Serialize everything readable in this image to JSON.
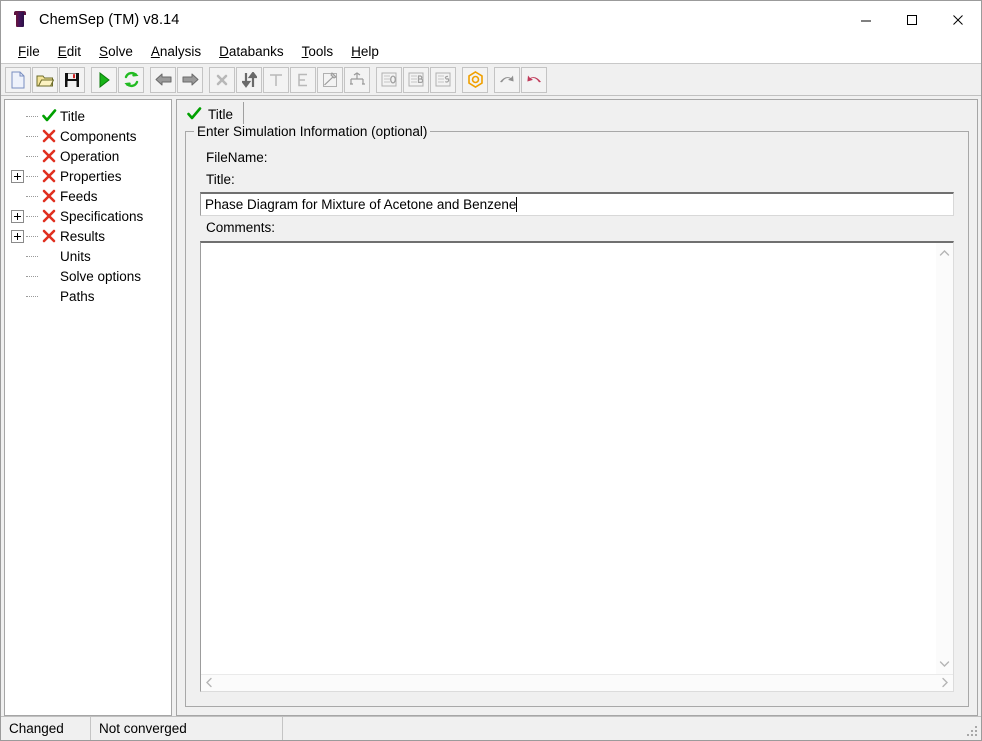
{
  "window": {
    "title": "ChemSep (TM) v8.14",
    "icon": "chemsep-flask-icon",
    "controls": {
      "minimize": "minimize-icon",
      "maximize": "maximize-icon",
      "close": "close-icon"
    }
  },
  "menubar": {
    "items": [
      {
        "label": "File",
        "accel": "F"
      },
      {
        "label": "Edit",
        "accel": "E"
      },
      {
        "label": "Solve",
        "accel": "S"
      },
      {
        "label": "Analysis",
        "accel": "A"
      },
      {
        "label": "Databanks",
        "accel": "D"
      },
      {
        "label": "Tools",
        "accel": "T"
      },
      {
        "label": "Help",
        "accel": "H"
      }
    ]
  },
  "toolbar": {
    "buttons": [
      {
        "name": "new-file-icon",
        "tip": "New",
        "enabled": true
      },
      {
        "name": "open-folder-icon",
        "tip": "Open",
        "enabled": true
      },
      {
        "name": "save-disk-icon",
        "tip": "Save",
        "enabled": true
      },
      {
        "name": "run-play-icon",
        "tip": "Solve",
        "enabled": true
      },
      {
        "name": "refresh-icon",
        "tip": "Refresh",
        "enabled": true
      },
      {
        "name": "arrow-left-icon",
        "tip": "Back",
        "enabled": true
      },
      {
        "name": "arrow-right-icon",
        "tip": "Forward",
        "enabled": true
      },
      {
        "name": "close-x-icon",
        "tip": "Close",
        "enabled": false
      },
      {
        "name": "sort-updown-icon",
        "tip": "Sort",
        "enabled": true
      },
      {
        "name": "table-t-icon",
        "tip": "Table",
        "enabled": false
      },
      {
        "name": "editor-e-icon",
        "tip": "Editor",
        "enabled": false
      },
      {
        "name": "plot-pen-icon",
        "tip": "Plot",
        "enabled": false
      },
      {
        "name": "flowsheet-icon",
        "tip": "Flowsheet",
        "enabled": false
      },
      {
        "name": "report-o-icon",
        "tip": "Report O",
        "enabled": false
      },
      {
        "name": "report-b-icon",
        "tip": "Report B",
        "enabled": false
      },
      {
        "name": "report-s-icon",
        "tip": "Report S",
        "enabled": false
      },
      {
        "name": "properties-hex-icon",
        "tip": "Properties",
        "enabled": true
      },
      {
        "name": "redo-arrow-icon",
        "tip": "Redo",
        "enabled": true
      },
      {
        "name": "undo-arrow-icon",
        "tip": "Undo",
        "enabled": true
      }
    ]
  },
  "sidebar": {
    "nodes": [
      {
        "label": "Title",
        "status": "check",
        "expandable": false
      },
      {
        "label": "Components",
        "status": "cross",
        "expandable": false
      },
      {
        "label": "Operation",
        "status": "cross",
        "expandable": false
      },
      {
        "label": "Properties",
        "status": "cross",
        "expandable": true
      },
      {
        "label": "Feeds",
        "status": "cross",
        "expandable": false
      },
      {
        "label": "Specifications",
        "status": "cross",
        "expandable": true
      },
      {
        "label": "Results",
        "status": "cross",
        "expandable": true
      },
      {
        "label": "Units",
        "status": "none",
        "expandable": false
      },
      {
        "label": "Solve options",
        "status": "none",
        "expandable": false
      },
      {
        "label": "Paths",
        "status": "none",
        "expandable": false
      }
    ]
  },
  "main": {
    "tabs": [
      {
        "label": "Title",
        "status": "check",
        "active": true
      }
    ],
    "groupbox": {
      "title": "Enter Simulation Information (optional)",
      "fields": {
        "filename_label": "FileName:",
        "filename_value": "",
        "title_label": "Title:",
        "title_value": "Phase Diagram for Mixture of Acetone and Benzene",
        "title_placeholder": "",
        "comments_label": "Comments:",
        "comments_value": "",
        "comments_placeholder": ""
      }
    },
    "scrollbars": {
      "vertical_up": "chevron-up-icon",
      "vertical_down": "chevron-down-icon",
      "horizontal_left": "chevron-left-icon",
      "horizontal_right": "chevron-right-icon"
    }
  },
  "statusbar": {
    "cells": [
      {
        "text": "Changed"
      },
      {
        "text": "Not converged"
      },
      {
        "text": ""
      }
    ]
  },
  "colors": {
    "check_green": "#00a000",
    "cross_red": "#e03020",
    "window_bg": "#f0f0f0",
    "field_bg": "#ffffff",
    "accent_orange": "#f0a000"
  }
}
